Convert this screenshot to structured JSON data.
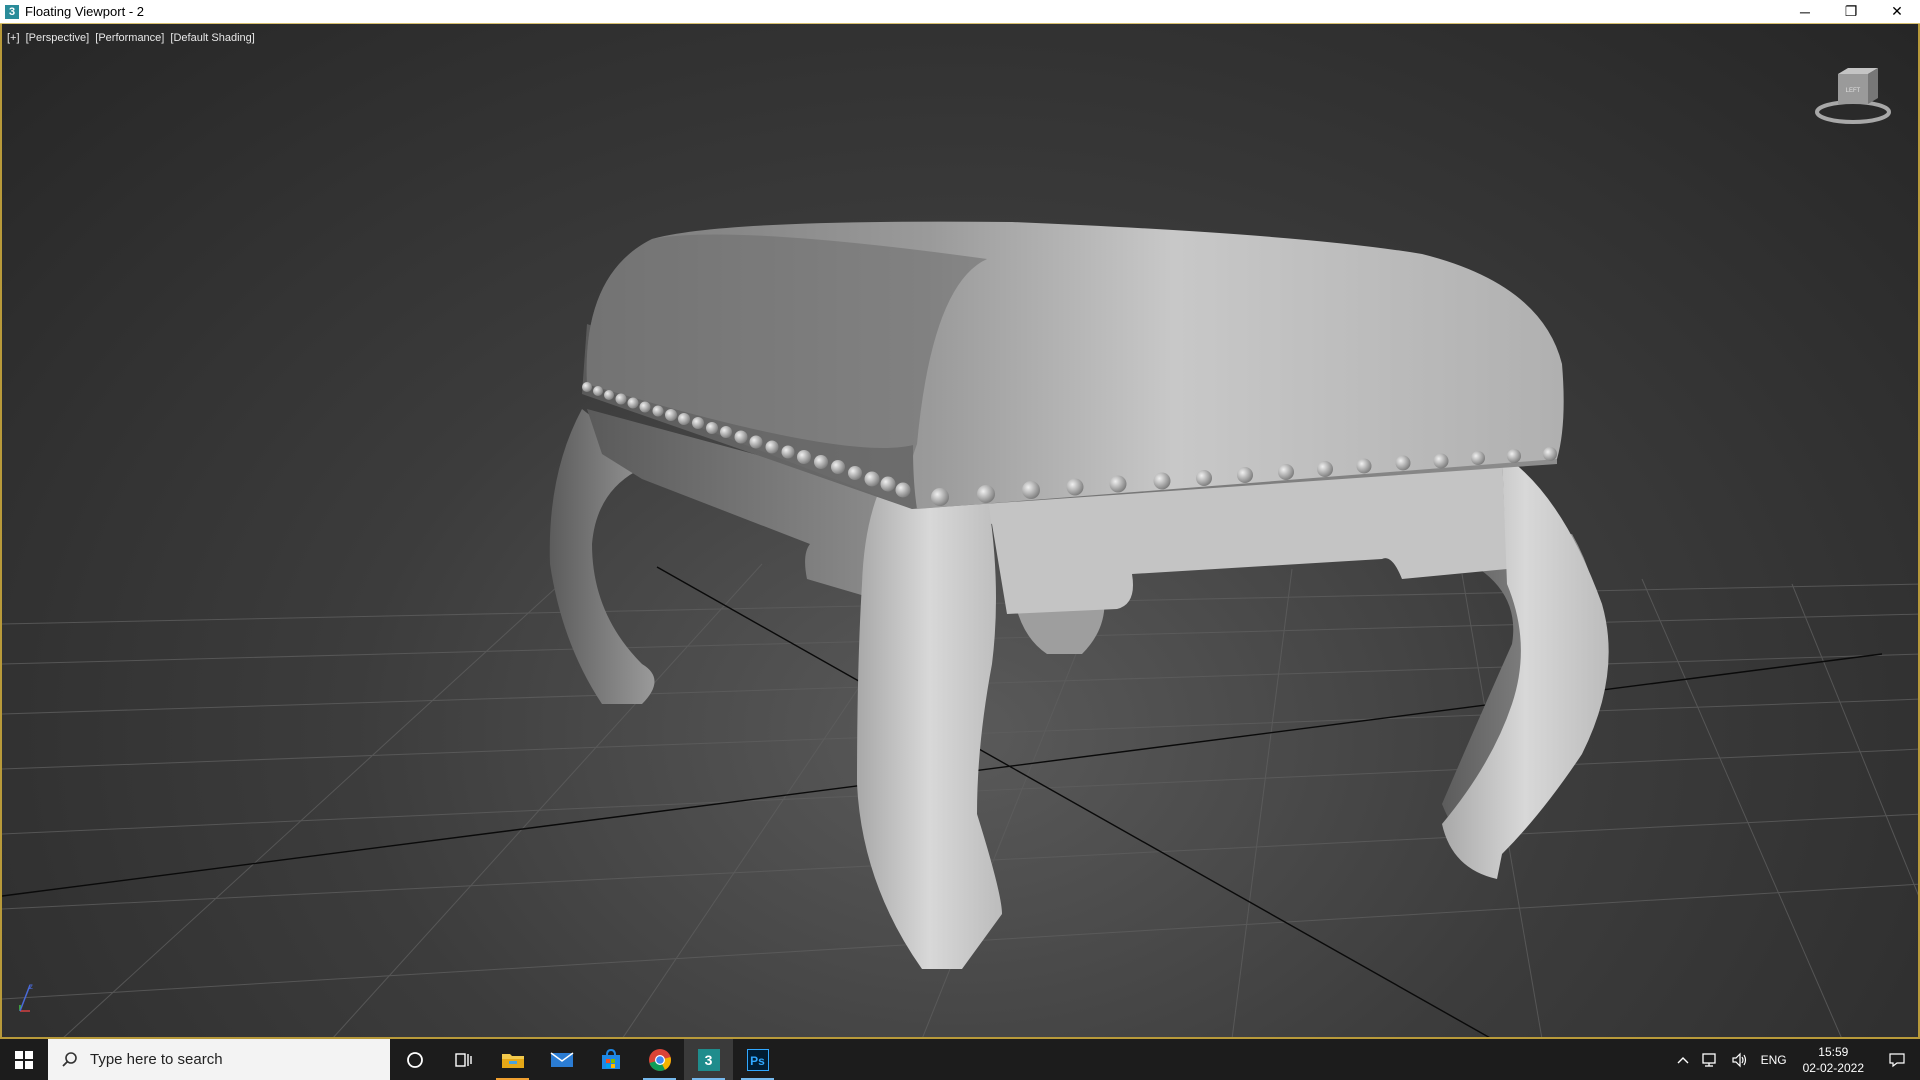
{
  "window": {
    "title": "Floating Viewport - 2",
    "app_icon_glyph": "3",
    "controls": {
      "minimize": "─",
      "restore": "❐",
      "close": "✕"
    }
  },
  "viewport": {
    "labels": [
      "[+]",
      "[Perspective]",
      "[Performance]",
      "[Default Shading]"
    ],
    "viewcube_face": "LEFT",
    "axis": {
      "x": "x",
      "y": "y",
      "z": "z"
    }
  },
  "taskbar": {
    "search_placeholder": "Type here to search",
    "apps": [
      {
        "name": "cortana-icon"
      },
      {
        "name": "task-view-icon"
      },
      {
        "name": "file-explorer-icon"
      },
      {
        "name": "mail-icon"
      },
      {
        "name": "store-icon"
      },
      {
        "name": "chrome-icon"
      },
      {
        "name": "3dsmax-icon"
      },
      {
        "name": "photoshop-icon"
      }
    ],
    "photoshop_label": "Ps",
    "max_label": "3",
    "tray": {
      "language": "ENG",
      "time": "15:59",
      "date": "02-02-2022"
    }
  },
  "colors": {
    "viewport_border": "#b89a3a",
    "taskbar_bg": "#1c1c1c",
    "active_indicator": "#76b9ed"
  }
}
